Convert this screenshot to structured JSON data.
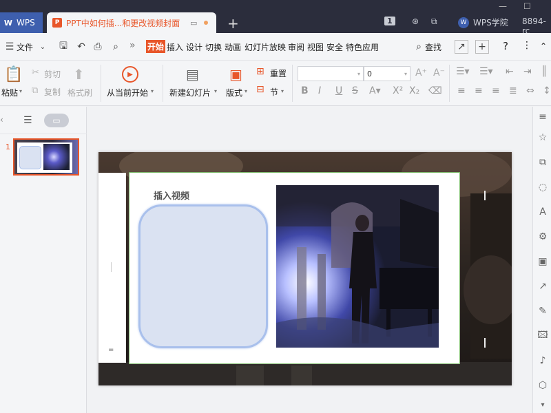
{
  "titlebar": {
    "app_tab": "WPS",
    "doc_title": "PPT中如何插...和更改视频封面",
    "doc_icon": "P",
    "new_tab": "+",
    "badge_count": "1",
    "academy": "WPS学院",
    "user": "8894-rc"
  },
  "menubar": {
    "file": "文件",
    "more": "»",
    "tabs": [
      "开始",
      "插入",
      "设计",
      "切换",
      "动画",
      "幻灯片放映",
      "审阅",
      "视图",
      "安全",
      "特色应用"
    ],
    "search": "查找",
    "help": "?",
    "more_menu": "⋮"
  },
  "ribbon": {
    "paste": "粘贴",
    "cut": "剪切",
    "copy": "复制",
    "format_painter": "格式刷",
    "from_current": "从当前开始",
    "new_slide": "新建幻灯片",
    "layout": "版式",
    "reset": "重置",
    "section": "节",
    "font_name": "",
    "font_size": "0"
  },
  "left_panel": {
    "slide_number": "1"
  },
  "slide": {
    "overlay_title": "插入视频"
  },
  "colors": {
    "accent": "#e8562a",
    "titlebar": "#2b2d3c",
    "wps_blue": "#3e5fae",
    "video_fill": "#dae2f2",
    "video_border": "#a9c0ec"
  }
}
